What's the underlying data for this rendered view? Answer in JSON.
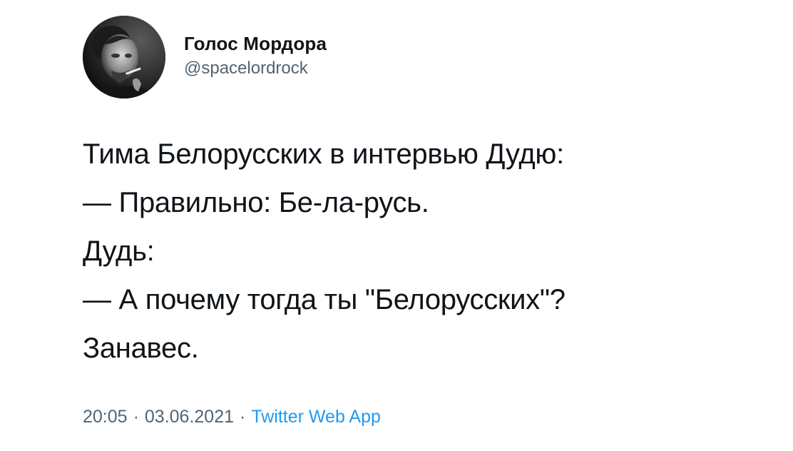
{
  "author": {
    "display_name": "Голос Мордора",
    "handle": "@spacelordrock"
  },
  "tweet": {
    "lines": [
      "Тима Белорусских в интервью Дудю:",
      "— Правильно: Бе-ла-русь.",
      "Дудь:",
      "— А почему тогда ты \"Белорусских\"?",
      "Занавес."
    ],
    "time": "20:05",
    "date": "03.06.2021",
    "separator": "·",
    "source": "Twitter Web App"
  },
  "colors": {
    "text": "#0f1419",
    "secondary": "#536471",
    "link": "#1d9bf0"
  },
  "icons": {
    "avatar": "profile-photo"
  }
}
